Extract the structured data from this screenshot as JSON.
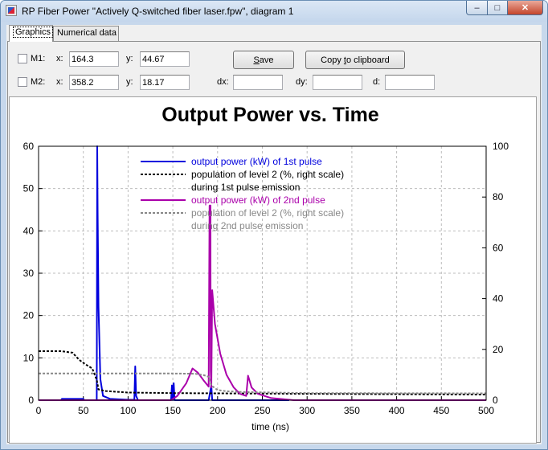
{
  "window": {
    "title": "RP Fiber Power \"Actively Q-switched fiber laser.fpw\", diagram 1",
    "minimize": "‒",
    "maximize": "□",
    "close": "✕"
  },
  "tabs": [
    {
      "label": "Graphics"
    },
    {
      "label": "Numerical data"
    }
  ],
  "markers": {
    "m1": {
      "label": "M1:",
      "x_label": "x:",
      "x": "164.3",
      "y_label": "y:",
      "y": "44.67"
    },
    "m2": {
      "label": "M2:",
      "x_label": "x:",
      "x": "358.2",
      "y_label": "y:",
      "y": "18.17"
    }
  },
  "buttons": {
    "save_pre": "",
    "save_ul": "S",
    "save_post": "ave",
    "copy_pre": "Copy ",
    "copy_ul": "t",
    "copy_post": "o clipboard"
  },
  "deltas": {
    "dx_label": "dx:",
    "dx": "",
    "dy_label": "dy:",
    "dy": "",
    "d_label": "d:",
    "d": ""
  },
  "chart_data": {
    "type": "line",
    "title": "Output Power vs. Time",
    "xlabel": "time (ns)",
    "ylabel": "",
    "xlim": [
      0,
      500
    ],
    "ylim": [
      0,
      60
    ],
    "y2lim": [
      0,
      100
    ],
    "x_ticks": [
      "0",
      "50",
      "100",
      "150",
      "200",
      "250",
      "300",
      "350",
      "400",
      "450",
      "500"
    ],
    "y_ticks": [
      "0",
      "10",
      "20",
      "30",
      "40",
      "50",
      "60"
    ],
    "y2_ticks": [
      "0",
      "20",
      "40",
      "60",
      "80",
      "100"
    ],
    "grid": true,
    "legend_position": "top-center",
    "series": [
      {
        "name": "output power (kW) of 1st pulse",
        "axis": "left",
        "color": "#0000dd",
        "style": "solid",
        "points": [
          [
            0,
            0
          ],
          [
            25,
            0
          ],
          [
            26,
            0.3
          ],
          [
            50,
            0.3
          ],
          [
            51,
            0
          ],
          [
            65,
            0
          ],
          [
            65.5,
            60
          ],
          [
            66,
            44.7
          ],
          [
            67,
            22
          ],
          [
            69,
            5
          ],
          [
            72,
            1
          ],
          [
            80,
            0.3
          ],
          [
            100,
            0.1
          ],
          [
            107,
            0.1
          ],
          [
            108,
            8
          ],
          [
            109,
            1
          ],
          [
            111,
            0
          ],
          [
            148,
            0
          ],
          [
            149,
            3.5
          ],
          [
            150,
            0
          ],
          [
            151,
            4
          ],
          [
            152,
            0
          ],
          [
            190,
            0
          ],
          [
            193,
            3.5
          ],
          [
            194,
            0
          ],
          [
            200,
            0
          ],
          [
            280,
            0
          ]
        ]
      },
      {
        "name": "population of level 2 (%, right scale)",
        "legend_line2": "during 1st pulse emission",
        "axis": "right",
        "color": "#000000",
        "style": "dashed",
        "points": [
          [
            0,
            19.3
          ],
          [
            25,
            19.3
          ],
          [
            38,
            18.7
          ],
          [
            45,
            16
          ],
          [
            52,
            14.2
          ],
          [
            60,
            12.5
          ],
          [
            65,
            8
          ],
          [
            67,
            4.2
          ],
          [
            75,
            3.6
          ],
          [
            100,
            3
          ],
          [
            150,
            2.8
          ],
          [
            300,
            2.5
          ],
          [
            500,
            2.2
          ]
        ]
      },
      {
        "name": "output power (kW) of 2nd pulse",
        "axis": "left",
        "color": "#aa00aa",
        "style": "solid",
        "points": [
          [
            0,
            0
          ],
          [
            148,
            0
          ],
          [
            155,
            1
          ],
          [
            165,
            4
          ],
          [
            172,
            7.5
          ],
          [
            178,
            6.5
          ],
          [
            185,
            4.5
          ],
          [
            190,
            3.2
          ],
          [
            191,
            46
          ],
          [
            192,
            46
          ],
          [
            192.3,
            7
          ],
          [
            193,
            3
          ],
          [
            194,
            26
          ],
          [
            197,
            18
          ],
          [
            203,
            11
          ],
          [
            210,
            6
          ],
          [
            218,
            3
          ],
          [
            225,
            1.5
          ],
          [
            232,
            1
          ],
          [
            234,
            5.8
          ],
          [
            238,
            3
          ],
          [
            245,
            1.5
          ],
          [
            260,
            0.5
          ],
          [
            285,
            0
          ],
          [
            500,
            0
          ]
        ]
      },
      {
        "name": "population of level 2 (%, right scale)",
        "legend_line2": "during 2nd pulse emission",
        "axis": "right",
        "color": "#888888",
        "style": "dashed",
        "points": [
          [
            0,
            10.5
          ],
          [
            150,
            10.5
          ],
          [
            175,
            10.4
          ],
          [
            185,
            9.8
          ],
          [
            190,
            9.2
          ],
          [
            193,
            5.8
          ],
          [
            200,
            4
          ],
          [
            210,
            3.5
          ],
          [
            230,
            3.2
          ],
          [
            300,
            2.8
          ],
          [
            500,
            2.7
          ]
        ]
      }
    ]
  }
}
